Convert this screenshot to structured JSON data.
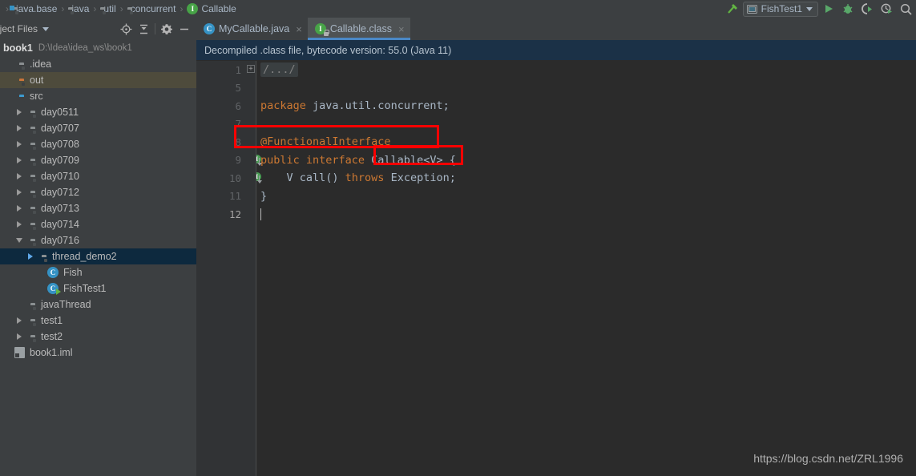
{
  "breadcrumb": {
    "name": "breadcrumb",
    "items": [
      {
        "label": "java.base",
        "icon": "module-folder-icon"
      },
      {
        "label": "java",
        "icon": "folder-icon"
      },
      {
        "label": "util",
        "icon": "folder-icon"
      },
      {
        "label": "concurrent",
        "icon": "folder-icon"
      },
      {
        "label": "Callable",
        "icon": "interface-icon",
        "glyph": "I"
      }
    ],
    "separator": "›"
  },
  "toolbar": {
    "build_icon": "hammer-icon",
    "run_config": {
      "label": "FishTest1",
      "icon": "run-config-icon"
    },
    "run_icon": "run-icon",
    "debug_icon": "debug-icon",
    "run_with_coverage_icon": "run-with-coverage-icon",
    "profile_icon": "profile-icon",
    "search_icon": "search-icon"
  },
  "project_panel": {
    "title": "oject Files",
    "dropdown_icon": "chevron-down-icon",
    "tools": [
      {
        "name": "select-opened-file-icon",
        "glyph": "target"
      },
      {
        "name": "collapse-all-icon",
        "glyph": "collapse"
      },
      {
        "name": "settings-gear-icon",
        "glyph": "gear"
      },
      {
        "name": "hide-panel-icon",
        "glyph": "minus"
      }
    ]
  },
  "tabs": [
    {
      "label": "MyCallable.java",
      "icon": "java-class-icon",
      "glyph": "C",
      "active": false,
      "close": "×"
    },
    {
      "label": "Callable.class",
      "icon": "interface-locked-icon",
      "glyph": "I",
      "active": true,
      "close": "×"
    }
  ],
  "tree": {
    "project": {
      "name": "book1",
      "path": "D:\\Idea\\idea_ws\\book1"
    },
    "items": [
      {
        "label": ".idea",
        "indent": 0,
        "arrow": "none",
        "icon": "folder-plain-icon",
        "state": "normal"
      },
      {
        "label": "out",
        "indent": 0,
        "arrow": "none",
        "icon": "folder-excluded-icon",
        "state": "highlight"
      },
      {
        "label": "src",
        "indent": 0,
        "arrow": "none",
        "icon": "folder-source-icon",
        "state": "normal"
      },
      {
        "label": "day0511",
        "indent": 1,
        "arrow": "right",
        "icon": "package-icon",
        "state": "normal"
      },
      {
        "label": "day0707",
        "indent": 1,
        "arrow": "right",
        "icon": "package-icon",
        "state": "normal"
      },
      {
        "label": "day0708",
        "indent": 1,
        "arrow": "right",
        "icon": "package-icon",
        "state": "normal"
      },
      {
        "label": "day0709",
        "indent": 1,
        "arrow": "right",
        "icon": "package-icon",
        "state": "normal"
      },
      {
        "label": "day0710",
        "indent": 1,
        "arrow": "right",
        "icon": "package-icon",
        "state": "normal"
      },
      {
        "label": "day0712",
        "indent": 1,
        "arrow": "right",
        "icon": "package-icon",
        "state": "normal"
      },
      {
        "label": "day0713",
        "indent": 1,
        "arrow": "right",
        "icon": "package-icon",
        "state": "normal"
      },
      {
        "label": "day0714",
        "indent": 1,
        "arrow": "right",
        "icon": "package-icon",
        "state": "normal"
      },
      {
        "label": "day0716",
        "indent": 1,
        "arrow": "down",
        "icon": "package-icon",
        "state": "normal"
      },
      {
        "label": "thread_demo2",
        "indent": 2,
        "arrow": "right-blue",
        "icon": "package-icon",
        "state": "selected"
      },
      {
        "label": "Fish",
        "indent": 3,
        "arrow": "none",
        "icon": "java-class-icon",
        "glyph": "C",
        "state": "normal"
      },
      {
        "label": "FishTest1",
        "indent": 3,
        "arrow": "none",
        "icon": "java-runnable-class-icon",
        "glyph": "C",
        "state": "normal"
      },
      {
        "label": "javaThread",
        "indent": 1,
        "arrow": "none",
        "icon": "package-icon",
        "state": "normal"
      },
      {
        "label": "test1",
        "indent": 1,
        "arrow": "right",
        "icon": "package-icon",
        "state": "normal"
      },
      {
        "label": "test2",
        "indent": 1,
        "arrow": "right",
        "icon": "package-icon",
        "state": "normal"
      },
      {
        "label": "book1.iml",
        "indent": 0,
        "arrow": "none",
        "icon": "iml-file-icon",
        "state": "normal"
      }
    ]
  },
  "editor": {
    "notification": "Decompiled .class file, bytecode version: 55.0 (Java 11)",
    "fold_expand_glyph": "+",
    "lines": [
      {
        "number": "1",
        "marker": "none",
        "tokens": [
          {
            "t": "/.../",
            "c": "folded"
          }
        ]
      },
      {
        "number": "5",
        "marker": "none",
        "tokens": []
      },
      {
        "number": "6",
        "marker": "none",
        "tokens": [
          {
            "t": "package",
            "c": "kw"
          },
          {
            "t": " java.util.concurrent;",
            "c": "plain"
          }
        ]
      },
      {
        "number": "7",
        "marker": "none",
        "tokens": []
      },
      {
        "number": "8",
        "marker": "none",
        "tokens": [
          {
            "t": "@FunctionalInterface",
            "c": "kw"
          }
        ]
      },
      {
        "number": "9",
        "marker": "implemented",
        "tokens": [
          {
            "t": "public interface ",
            "c": "kw"
          },
          {
            "t": "Callable<V> {",
            "c": "plain"
          }
        ]
      },
      {
        "number": "10",
        "marker": "implemented",
        "tokens": [
          {
            "t": "    V call() ",
            "c": "plain"
          },
          {
            "t": "throws",
            "c": "kw"
          },
          {
            "t": " Exception;",
            "c": "plain"
          }
        ]
      },
      {
        "number": "11",
        "marker": "none",
        "tokens": [
          {
            "t": "}",
            "c": "plain"
          }
        ]
      },
      {
        "number": "12",
        "marker": "none",
        "tokens": [],
        "current": true
      }
    ]
  },
  "annotations": [
    {
      "name": "annotation-box-functional-interface",
      "color": "#ff0000"
    },
    {
      "name": "annotation-box-callable-generic",
      "color": "#ff0000"
    }
  ],
  "watermark": "https://blog.csdn.net/ZRL1996"
}
